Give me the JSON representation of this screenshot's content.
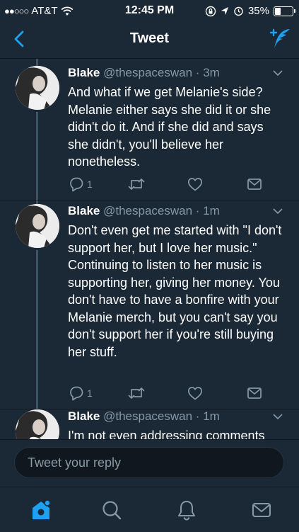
{
  "status_bar": {
    "signal": "●●○○○",
    "carrier": "AT&T",
    "time": "12:45 PM",
    "battery": "35%",
    "battery_level": 0.35
  },
  "nav": {
    "title": "Tweet"
  },
  "tweets": [
    {
      "name": "Blake",
      "handle": "@thespaceswan",
      "separator": "·",
      "time": "3m",
      "text": "And what if we get Melanie's side? Melanie either says she did it or she didn't do it. And if she did and says she didn't, you'll believe her nonetheless.",
      "reply_count": "1"
    },
    {
      "name": "Blake",
      "handle": "@thespaceswan",
      "separator": "·",
      "time": "1m",
      "text": "Don't even get me started with \"I don't support her, but I love her music.\" Continuing to listen to her music is supporting her, giving her money. You don't have to have a bonfire with your Melanie merch, but you can't say you don't support her if you're still buying her stuff.",
      "reply_count": "1"
    },
    {
      "name": "Blake",
      "handle": "@thespaceswan",
      "separator": "·",
      "time": "1m",
      "text": "I'm not even addressing comments"
    }
  ],
  "reply": {
    "placeholder": "Tweet your reply"
  },
  "colors": {
    "background": "#1b2836",
    "accent": "#1da1f2",
    "muted": "#8899a6"
  },
  "icons": {
    "back": "chevron-left-icon",
    "compose": "compose-tweet-icon",
    "reply": "reply-icon",
    "retweet": "retweet-icon",
    "like": "heart-icon",
    "dm": "envelope-icon",
    "home": "home-icon",
    "search": "search-icon",
    "notifications": "bell-icon",
    "messages": "envelope-icon"
  }
}
